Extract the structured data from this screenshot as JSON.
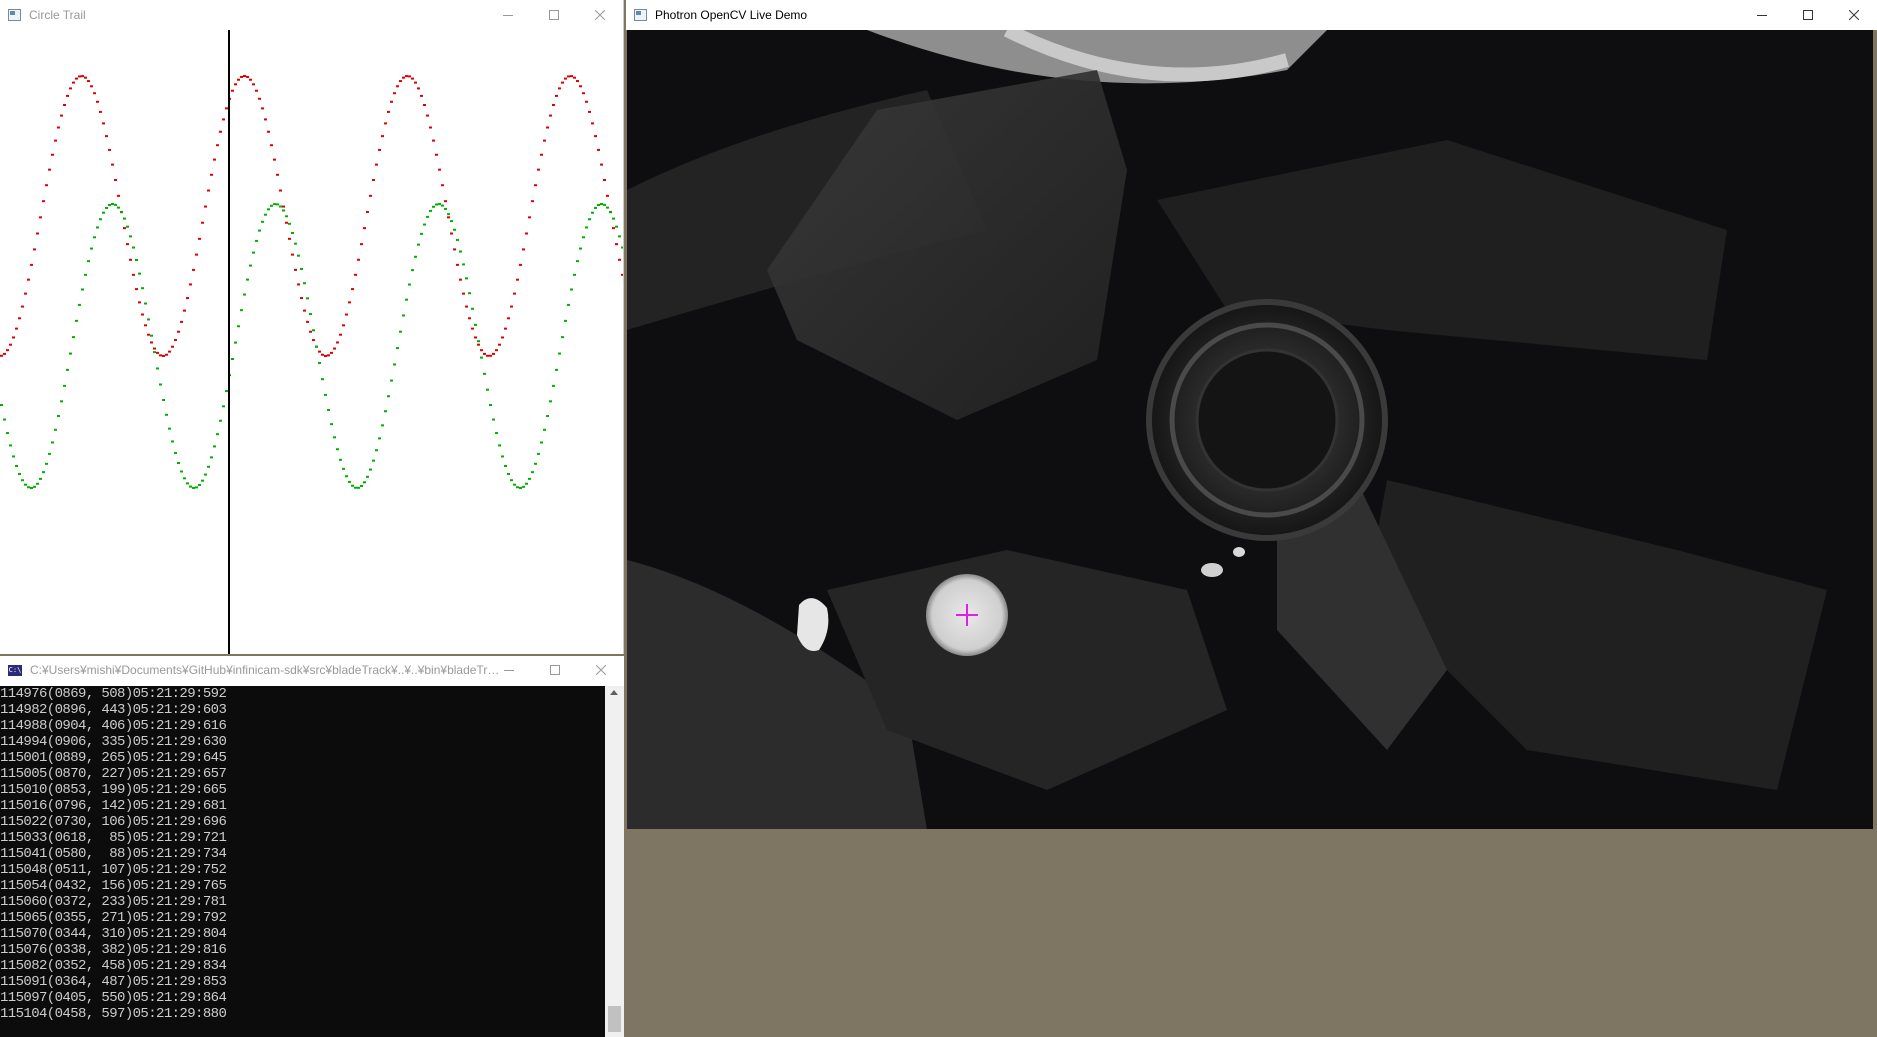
{
  "trail_window": {
    "title": "Circle Trail",
    "icon": "app-window-icon",
    "controls": [
      "minimize-icon",
      "maximize-icon",
      "close-icon"
    ],
    "series": [
      {
        "color": "#e00000",
        "label": "red"
      },
      {
        "color": "#00b000",
        "label": "green"
      }
    ],
    "cursor_line_color": "#000000"
  },
  "console_window": {
    "title": "C:¥Users¥mishi¥Documents¥GitHub¥infinicam-sdk¥src¥bladeTrack¥..¥..¥bin¥bladeTra...",
    "icon_text": "C:\\",
    "lines": [
      "114976(0869, 508)05:21:29:592",
      "114982(0896, 443)05:21:29:603",
      "114988(0904, 406)05:21:29:616",
      "114994(0906, 335)05:21:29:630",
      "115001(0889, 265)05:21:29:645",
      "115005(0870, 227)05:21:29:657",
      "115010(0853, 199)05:21:29:665",
      "115016(0796, 142)05:21:29:681",
      "115022(0730, 106)05:21:29:696",
      "115033(0618,  85)05:21:29:721",
      "115041(0580,  88)05:21:29:734",
      "115048(0511, 107)05:21:29:752",
      "115054(0432, 156)05:21:29:765",
      "115060(0372, 233)05:21:29:781",
      "115065(0355, 271)05:21:29:792",
      "115070(0344, 310)05:21:29:804",
      "115076(0338, 382)05:21:29:816",
      "115082(0352, 458)05:21:29:834",
      "115091(0364, 487)05:21:29:853",
      "115097(0405, 550)05:21:29:864",
      "115104(0458, 597)05:21:29:880"
    ]
  },
  "live_window": {
    "title": "Photron OpenCV Live Demo",
    "icon": "app-window-icon",
    "controls": [
      "minimize-icon",
      "maximize-icon",
      "close-icon"
    ],
    "marker_color": "#e020e0",
    "marker_icon": "crosshair-icon"
  }
}
